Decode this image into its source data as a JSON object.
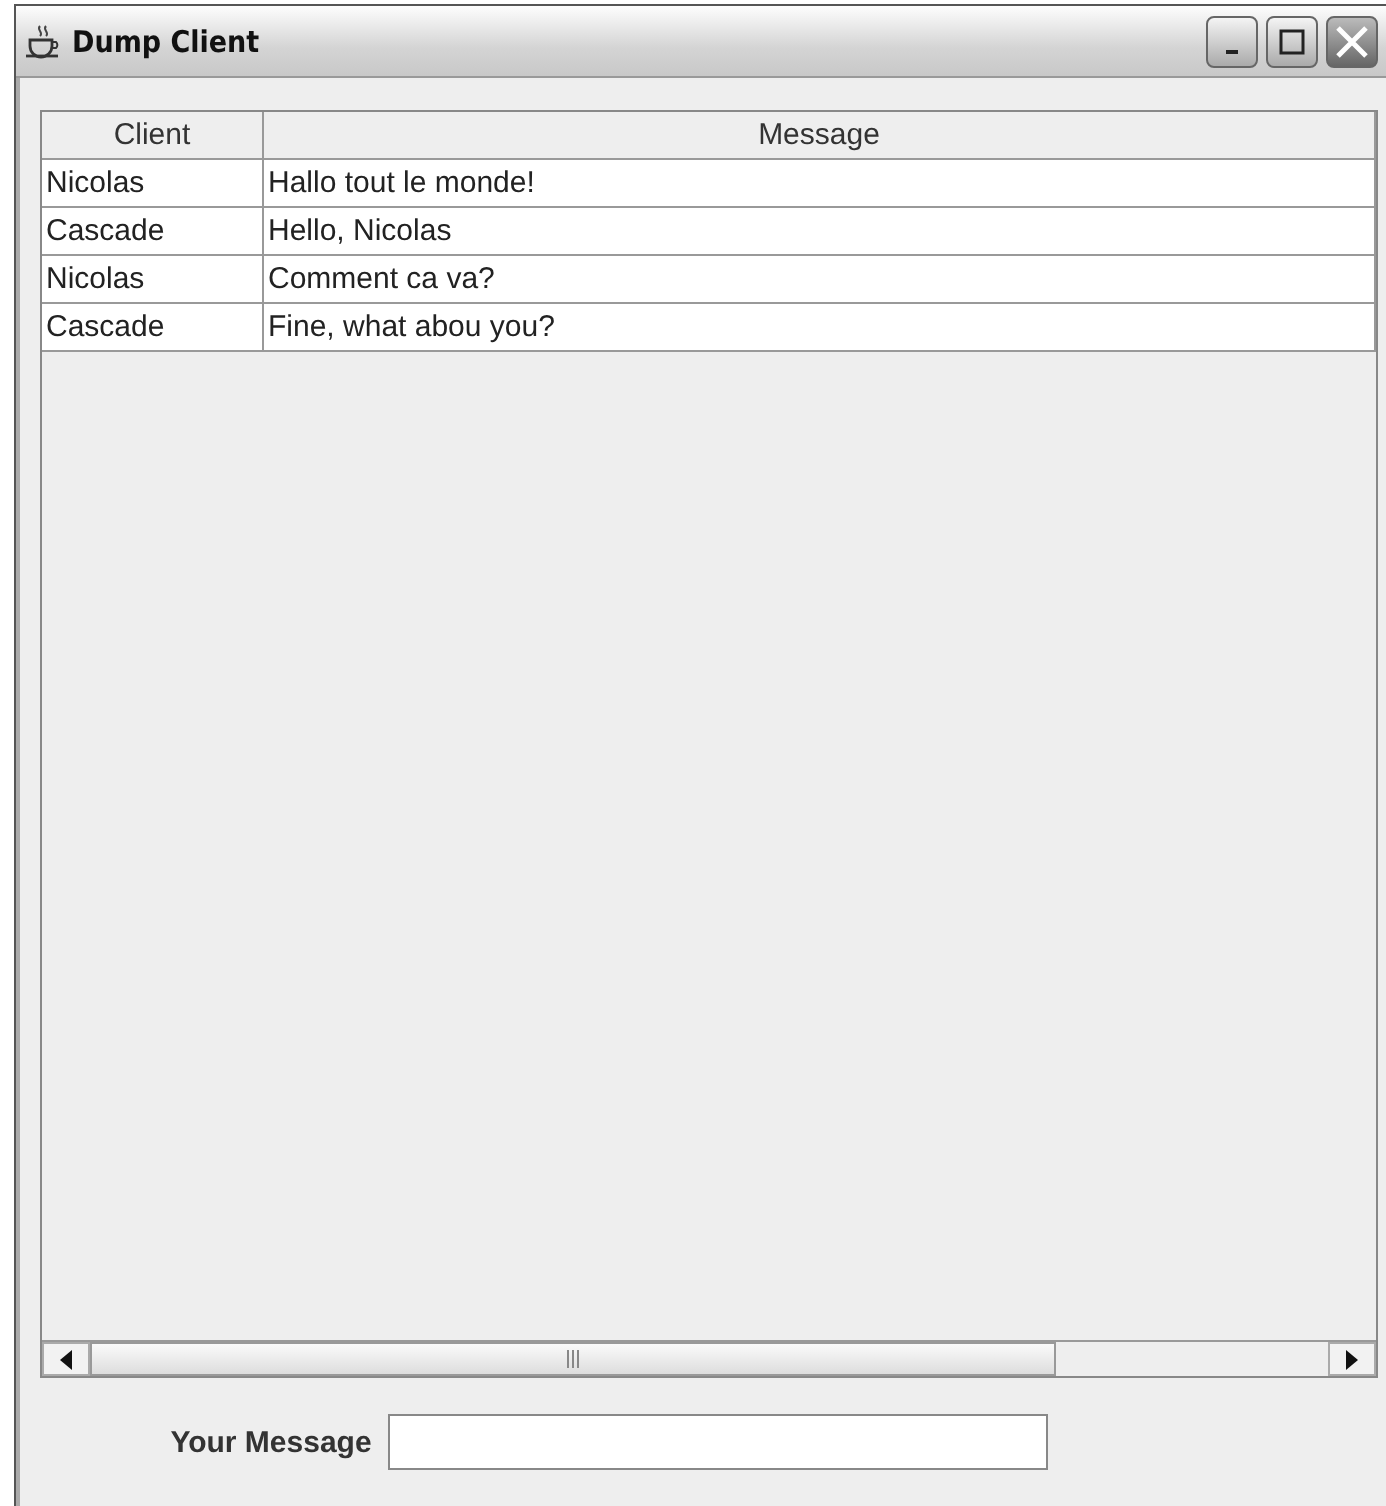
{
  "window": {
    "title": "Dump Client"
  },
  "table": {
    "columns": [
      "Client",
      "Message"
    ],
    "rows": [
      [
        "Nicolas",
        "Hallo tout le monde!"
      ],
      [
        "Cascade",
        "Hello, Nicolas"
      ],
      [
        "Nicolas",
        "Comment ca va?"
      ],
      [
        "Cascade",
        "Fine, what abou you?"
      ]
    ]
  },
  "message_field": {
    "label": "Your Message"
  }
}
